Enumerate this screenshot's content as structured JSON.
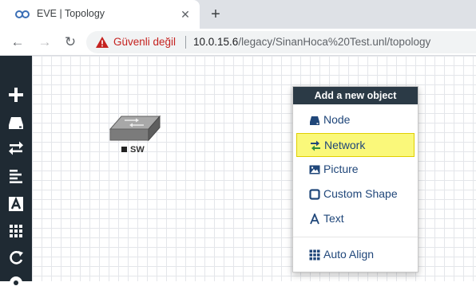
{
  "browser": {
    "tab_title": "EVE | Topology",
    "tab_close_glyph": "✕",
    "new_tab_glyph": "+",
    "back_glyph": "←",
    "forward_glyph": "→",
    "reload_glyph": "↻",
    "security_label": "Güvenli değil",
    "url_host": "10.0.15.6",
    "url_path": "/legacy/SinanHoca%20Test.unl/topology"
  },
  "sidebar": {
    "items": [
      {
        "icon": "plus-icon"
      },
      {
        "icon": "hard-drive-icon"
      },
      {
        "icon": "exchange-icon"
      },
      {
        "icon": "align-left-icon"
      },
      {
        "icon": "text-a-icon"
      },
      {
        "icon": "grid-icon"
      },
      {
        "icon": "refresh-icon"
      },
      {
        "icon": "settings-icon"
      }
    ]
  },
  "canvas": {
    "node_label": "SW",
    "node_icon": "switch-icon"
  },
  "context_menu": {
    "title": "Add a new object",
    "items": [
      {
        "label": "Node",
        "icon": "hard-drive-icon"
      },
      {
        "label": "Network",
        "icon": "exchange-icon",
        "highlighted": true
      },
      {
        "label": "Picture",
        "icon": "picture-icon"
      },
      {
        "label": "Custom Shape",
        "icon": "square-icon"
      },
      {
        "label": "Text",
        "icon": "text-a-icon"
      },
      {
        "label": "Auto Align",
        "icon": "grid-icon"
      }
    ]
  },
  "colors": {
    "sidebar_bg": "#1f2a33",
    "menu_header_bg": "#2b3a46",
    "menu_link": "#20477a",
    "highlight": "#faf87a",
    "warning": "#c5221f"
  }
}
